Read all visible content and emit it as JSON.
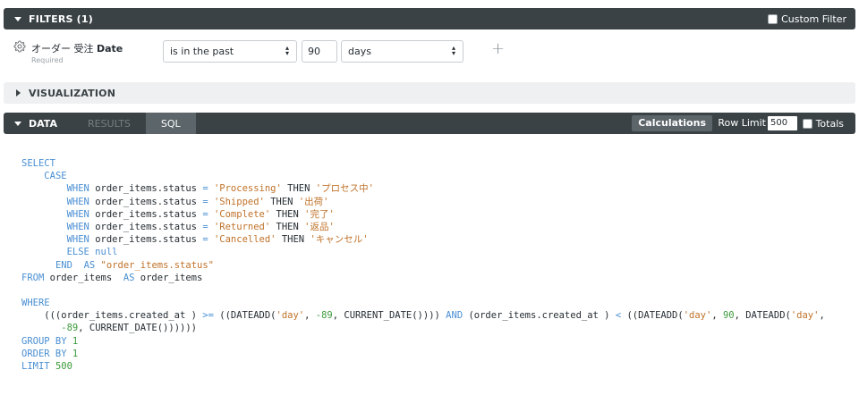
{
  "filters": {
    "header": "FILTERS (1)",
    "custom_filter_label": "Custom Filter",
    "field": {
      "view": "オーダー 受注",
      "name": "Date",
      "required": "Required"
    },
    "operator": "is in the past",
    "value": "90",
    "unit": "days",
    "add_icon": "+"
  },
  "visualization": {
    "header": "VISUALIZATION"
  },
  "data": {
    "tabs": [
      "DATA",
      "RESULTS",
      "SQL"
    ],
    "active_tab": "SQL",
    "calculations_label": "Calculations",
    "row_limit_label": "Row Limit",
    "row_limit_value": "500",
    "totals_label": "Totals"
  },
  "sql": {
    "lines": [
      [
        [
          "kw",
          "SELECT"
        ]
      ],
      [
        [
          "t",
          "    "
        ],
        [
          "kw",
          "CASE"
        ]
      ],
      [
        [
          "t",
          "        "
        ],
        [
          "kw",
          "WHEN"
        ],
        [
          "t",
          " order_items.status "
        ],
        [
          "op",
          "="
        ],
        [
          "t",
          " "
        ],
        [
          "str",
          "'Processing'"
        ],
        [
          "t",
          " THEN "
        ],
        [
          "str",
          "'プロセス中'"
        ]
      ],
      [
        [
          "t",
          "        "
        ],
        [
          "kw",
          "WHEN"
        ],
        [
          "t",
          " order_items.status "
        ],
        [
          "op",
          "="
        ],
        [
          "t",
          " "
        ],
        [
          "str",
          "'Shipped'"
        ],
        [
          "t",
          " THEN "
        ],
        [
          "str",
          "'出荷'"
        ]
      ],
      [
        [
          "t",
          "        "
        ],
        [
          "kw",
          "WHEN"
        ],
        [
          "t",
          " order_items.status "
        ],
        [
          "op",
          "="
        ],
        [
          "t",
          " "
        ],
        [
          "str",
          "'Complete'"
        ],
        [
          "t",
          " THEN "
        ],
        [
          "str",
          "'完了'"
        ]
      ],
      [
        [
          "t",
          "        "
        ],
        [
          "kw",
          "WHEN"
        ],
        [
          "t",
          " order_items.status "
        ],
        [
          "op",
          "="
        ],
        [
          "t",
          " "
        ],
        [
          "str",
          "'Returned'"
        ],
        [
          "t",
          " THEN "
        ],
        [
          "str",
          "'返品'"
        ]
      ],
      [
        [
          "t",
          "        "
        ],
        [
          "kw",
          "WHEN"
        ],
        [
          "t",
          " order_items.status "
        ],
        [
          "op",
          "="
        ],
        [
          "t",
          " "
        ],
        [
          "str",
          "'Cancelled'"
        ],
        [
          "t",
          " THEN "
        ],
        [
          "str",
          "'キャンセル'"
        ]
      ],
      [
        [
          "t",
          "        "
        ],
        [
          "kw",
          "ELSE null"
        ]
      ],
      [
        [
          "t",
          "      "
        ],
        [
          "kw",
          "END"
        ],
        [
          "t",
          "  "
        ],
        [
          "kw",
          "AS"
        ],
        [
          "t",
          " "
        ],
        [
          "str",
          "\"order_items.status\""
        ]
      ],
      [
        [
          "kw",
          "FROM"
        ],
        [
          "t",
          " order_items  "
        ],
        [
          "kw",
          "AS"
        ],
        [
          "t",
          " order_items"
        ]
      ],
      [
        [
          "t",
          ""
        ]
      ],
      [
        [
          "kw",
          "WHERE"
        ]
      ],
      [
        [
          "t",
          "    (((order_items.created_at ) "
        ],
        [
          "op",
          ">="
        ],
        [
          "t",
          " ((DATEADD("
        ],
        [
          "str",
          "'day'"
        ],
        [
          "t",
          ", "
        ],
        [
          "num",
          "-89"
        ],
        [
          "t",
          ", CURRENT_DATE()))) "
        ],
        [
          "kw",
          "AND"
        ],
        [
          "t",
          " (order_items.created_at ) "
        ],
        [
          "op",
          "<"
        ],
        [
          "t",
          " ((DATEADD("
        ],
        [
          "str",
          "'day'"
        ],
        [
          "t",
          ", "
        ],
        [
          "num",
          "90"
        ],
        [
          "t",
          ", DATEADD("
        ],
        [
          "str",
          "'day'"
        ],
        [
          "t",
          ","
        ]
      ],
      [
        [
          "t",
          "       "
        ],
        [
          "num",
          "-89"
        ],
        [
          "t",
          ", CURRENT_DATE())))))"
        ]
      ],
      [
        [
          "kw",
          "GROUP BY"
        ],
        [
          "t",
          " "
        ],
        [
          "num",
          "1"
        ]
      ],
      [
        [
          "kw",
          "ORDER BY"
        ],
        [
          "t",
          " "
        ],
        [
          "num",
          "1"
        ]
      ],
      [
        [
          "kw",
          "LIMIT"
        ],
        [
          "t",
          " "
        ],
        [
          "num",
          "500"
        ]
      ]
    ]
  }
}
